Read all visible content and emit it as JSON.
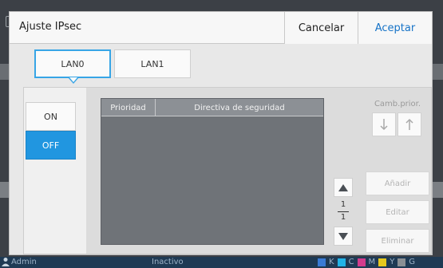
{
  "dialog": {
    "title": "Ajuste IPsec",
    "cancel_label": "Cancelar",
    "accept_label": "Aceptar"
  },
  "tabs": [
    {
      "label": "LAN0",
      "active": true
    },
    {
      "label": "LAN1",
      "active": false
    }
  ],
  "toggle": {
    "on_label": "ON",
    "off_label": "OFF",
    "selected": "OFF"
  },
  "table": {
    "columns": [
      "Prioridad",
      "Directiva de seguridad"
    ],
    "rows": []
  },
  "priority": {
    "label": "Camb.prior.",
    "down_icon": "arrow-down-icon",
    "up_icon": "arrow-up-icon"
  },
  "paging": {
    "current": "1",
    "total": "1"
  },
  "actions": {
    "add_label": "Añadir",
    "edit_label": "Editar",
    "delete_label": "Eliminar"
  },
  "statusbar": {
    "user": "Admin",
    "state": "Inactivo",
    "toner": [
      "K",
      "C",
      "M",
      "Y",
      "G"
    ]
  },
  "colors": {
    "accent": "#2196e0",
    "accept_text": "#1673c7",
    "active_tab_border": "#37a5e6"
  }
}
